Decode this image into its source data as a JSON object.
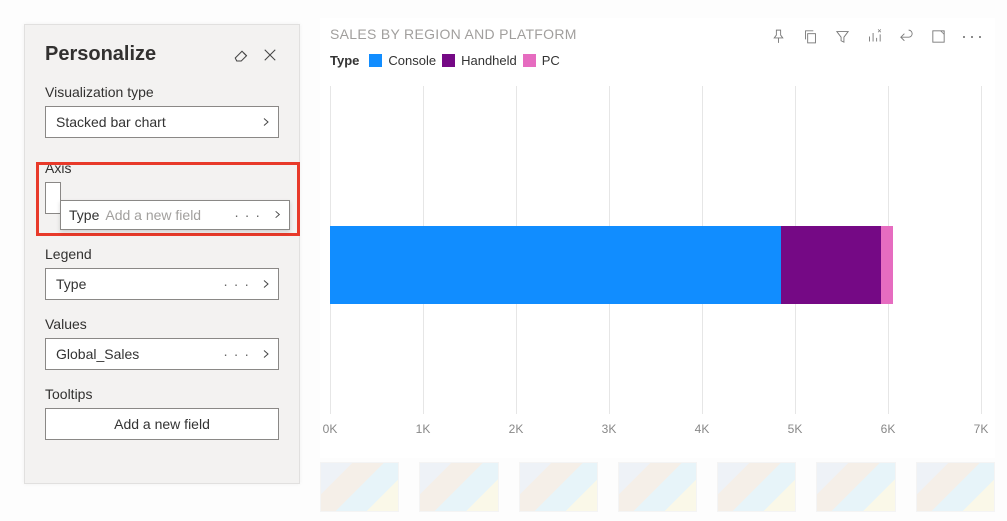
{
  "panel": {
    "title": "Personalize",
    "sections": {
      "viz_label": "Visualization type",
      "viz_value": "Stacked bar chart",
      "axis_label": "Axis",
      "axis_drag_value": "Type",
      "axis_placeholder": "Add a new field",
      "legend_label": "Legend",
      "legend_value": "Type",
      "values_label": "Values",
      "values_value": "Global_Sales",
      "tooltips_label": "Tooltips",
      "tooltips_add": "Add a new field"
    }
  },
  "visual": {
    "title": "SALES BY REGION AND PLATFORM",
    "legend_title": "Type",
    "legend_items": [
      {
        "name": "Console",
        "color": "#118dff"
      },
      {
        "name": "Handheld",
        "color": "#750985"
      },
      {
        "name": "PC",
        "color": "#e66cc0"
      }
    ],
    "axis_ticks": [
      "0K",
      "1K",
      "2K",
      "3K",
      "4K",
      "5K",
      "6K",
      "7K"
    ]
  },
  "chart_data": {
    "type": "bar",
    "orientation": "horizontal",
    "stacked": true,
    "xlim": [
      0,
      7000
    ],
    "series": [
      {
        "name": "Console",
        "value": 4850,
        "color": "#118dff"
      },
      {
        "name": "Handheld",
        "value": 1080,
        "color": "#750985"
      },
      {
        "name": "PC",
        "value": 120,
        "color": "#e66cc0"
      }
    ],
    "ticks_K": [
      0,
      1,
      2,
      3,
      4,
      5,
      6,
      7
    ]
  }
}
